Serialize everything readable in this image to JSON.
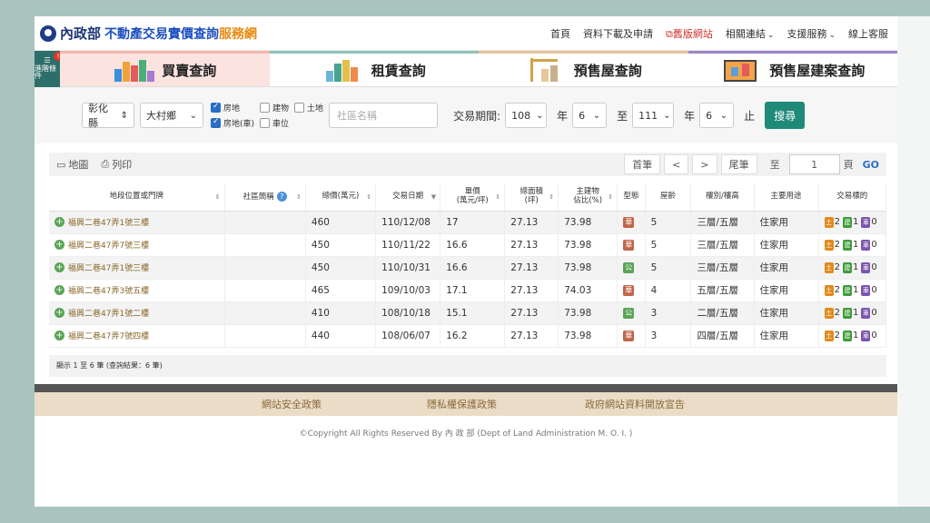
{
  "header": {
    "logo_ministry": "內政部",
    "logo_main": "不動產交易實價查詢",
    "logo_suffix": "服務網",
    "nav": [
      {
        "label": "首頁",
        "style": "normal"
      },
      {
        "label": "資料下載及申請",
        "style": "normal"
      },
      {
        "label": "舊版網站",
        "style": "old"
      },
      {
        "label": "相關連結",
        "style": "dropdown"
      },
      {
        "label": "支援服務",
        "style": "dropdown"
      },
      {
        "label": "線上客服",
        "style": "normal"
      }
    ]
  },
  "filter_badge": {
    "label": "進階條件",
    "count": "!"
  },
  "tabs": [
    {
      "label": "買賣查詢",
      "active": true
    },
    {
      "label": "租賃查詢",
      "active": false
    },
    {
      "label": "預售屋查詢",
      "active": false
    },
    {
      "label": "預售屋建案查詢",
      "active": false
    }
  ],
  "search": {
    "county": "彰化縣",
    "township": "大村鄉",
    "types": [
      {
        "label": "房地",
        "checked": true
      },
      {
        "label": "建物",
        "checked": false
      },
      {
        "label": "土地",
        "checked": false
      },
      {
        "label": "房地(車)",
        "checked": true
      },
      {
        "label": "車位",
        "checked": false
      }
    ],
    "community_placeholder": "社區名稱",
    "period_label": "交易期間",
    "colon": ":",
    "from_year": "108",
    "year_label": "年",
    "from_month": "6",
    "to_label": "至",
    "to_year": "111",
    "to_month": "6",
    "end_label": "止",
    "search_label": "搜尋"
  },
  "toolbar": {
    "map_label": "地圖",
    "print_label": "列印",
    "first_label": "首筆",
    "prev_label": "<",
    "next_label": ">",
    "last_label": "尾筆",
    "to_label": "至",
    "page_value": "1",
    "page_unit": "頁",
    "go_label": "GO"
  },
  "table": {
    "headers": [
      "地段位置或門牌",
      "社區簡稱",
      "總價(萬元)",
      "交易日期",
      "單價\n(萬元/坪)",
      "總面積\n(坪)",
      "主建物\n佔比(%)",
      "型態",
      "屋齡",
      "樓別/樓高",
      "主要用途",
      "交易標的"
    ],
    "rows": [
      {
        "addr": "福興二巷47弄1號三樓",
        "community": "",
        "total": "460",
        "date": "110/12/08",
        "unit": "17",
        "area": "27.13",
        "ratio": "73.98",
        "type": "華",
        "type_color": "#c0654a",
        "age": "5",
        "floor": "三層/五層",
        "use": "住家用",
        "tx": [
          "2",
          "1",
          "0"
        ]
      },
      {
        "addr": "福興二巷47弄7號三樓",
        "community": "",
        "total": "450",
        "date": "110/11/22",
        "unit": "16.6",
        "area": "27.13",
        "ratio": "73.98",
        "type": "華",
        "type_color": "#c0654a",
        "age": "5",
        "floor": "三層/五層",
        "use": "住家用",
        "tx": [
          "2",
          "1",
          "0"
        ]
      },
      {
        "addr": "福興二巷47弄1號三樓",
        "community": "",
        "total": "450",
        "date": "110/10/31",
        "unit": "16.6",
        "area": "27.13",
        "ratio": "73.98",
        "type": "公",
        "type_color": "#5aa454",
        "age": "5",
        "floor": "三層/五層",
        "use": "住家用",
        "tx": [
          "2",
          "1",
          "0"
        ]
      },
      {
        "addr": "福興二巷47弄3號五樓",
        "community": "",
        "total": "465",
        "date": "109/10/03",
        "unit": "17.1",
        "area": "27.13",
        "ratio": "74.03",
        "type": "華",
        "type_color": "#c0654a",
        "age": "4",
        "floor": "五層/五層",
        "use": "住家用",
        "tx": [
          "2",
          "1",
          "0"
        ]
      },
      {
        "addr": "福興二巷47弄1號二樓",
        "community": "",
        "total": "410",
        "date": "108/10/18",
        "unit": "15.1",
        "area": "27.13",
        "ratio": "73.98",
        "type": "公",
        "type_color": "#5aa454",
        "age": "3",
        "floor": "二層/五層",
        "use": "住家用",
        "tx": [
          "2",
          "1",
          "0"
        ]
      },
      {
        "addr": "福興二巷47弄7號四樓",
        "community": "",
        "total": "440",
        "date": "108/06/07",
        "unit": "16.2",
        "area": "27.13",
        "ratio": "73.98",
        "type": "華",
        "type_color": "#c0654a",
        "age": "3",
        "floor": "四層/五層",
        "use": "住家用",
        "tx": [
          "2",
          "1",
          "0"
        ]
      }
    ],
    "tx_badges": [
      {
        "label": "土",
        "color": "#e08a1c"
      },
      {
        "label": "建",
        "color": "#3f9c3a"
      },
      {
        "label": "車",
        "color": "#7b55b0"
      }
    ]
  },
  "summary": "顯示 1 至 6 筆 (查詢結果：6 筆)",
  "footer": {
    "links": [
      "網站安全政策",
      "隱私權保護政策",
      "政府網站資料開放宣告"
    ],
    "copyright": "©Copyright All Rights Reserved By 內 政 部 (Dept of Land Administration M. O. I. )"
  }
}
